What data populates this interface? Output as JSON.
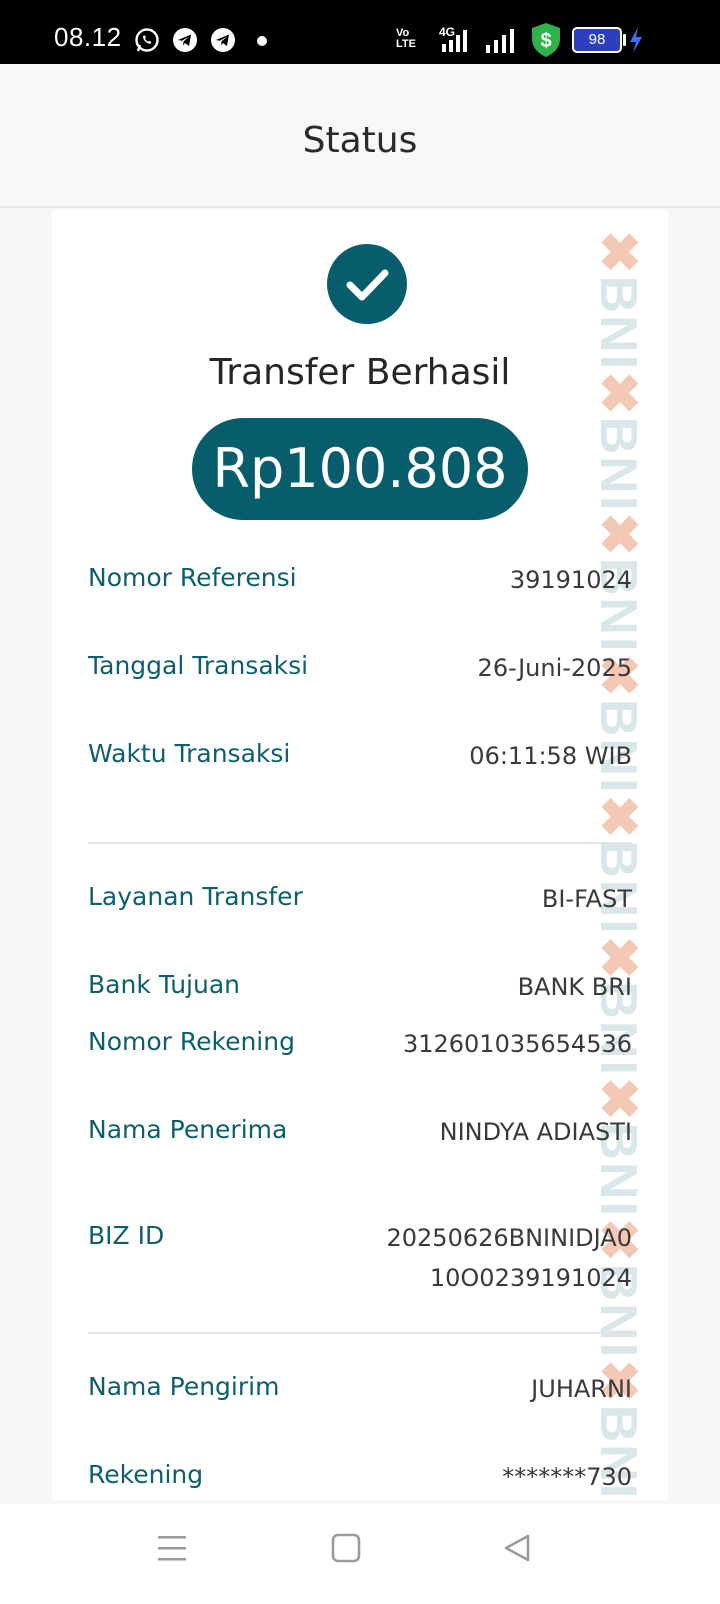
{
  "status_bar": {
    "time": "08.12",
    "network_volte": "Vo LTE",
    "network_type": "4G",
    "battery": "98",
    "colors": {
      "dollar_badge": "#2fb24a",
      "battery_fill": "#2c3fbf",
      "charging": "#3b6fff"
    }
  },
  "header": {
    "title": "Status"
  },
  "receipt": {
    "title": "Transfer Berhasil",
    "amount": "Rp100.808",
    "watermark": "BNI",
    "colors": {
      "primary": "#075d6c"
    },
    "section1": [
      {
        "label": "Nomor Referensi",
        "value": "39191024"
      },
      {
        "label": "Tanggal Transaksi",
        "value": "26-Juni-2025"
      },
      {
        "label": "Waktu Transaksi",
        "value": "06:11:58 WIB"
      }
    ],
    "section2": [
      {
        "label": "Layanan Transfer",
        "value": "BI-FAST"
      },
      {
        "label": "Bank Tujuan",
        "value": "BANK BRI"
      },
      {
        "label": "Nomor Rekening",
        "value": "312601035654536"
      },
      {
        "label": "Nama Penerima",
        "value": "NINDYA ADIASTI"
      },
      {
        "label": "BIZ ID",
        "value": "20250626BNINIDJA0 10O0239191024"
      }
    ],
    "section3": [
      {
        "label": "Nama Pengirim",
        "value": "JUHARNI"
      },
      {
        "label": "Rekening",
        "value": "*******730"
      }
    ]
  },
  "navbar": {
    "menu_icon": "menu-icon",
    "home_icon": "square-icon",
    "back_icon": "back-triangle-icon"
  }
}
